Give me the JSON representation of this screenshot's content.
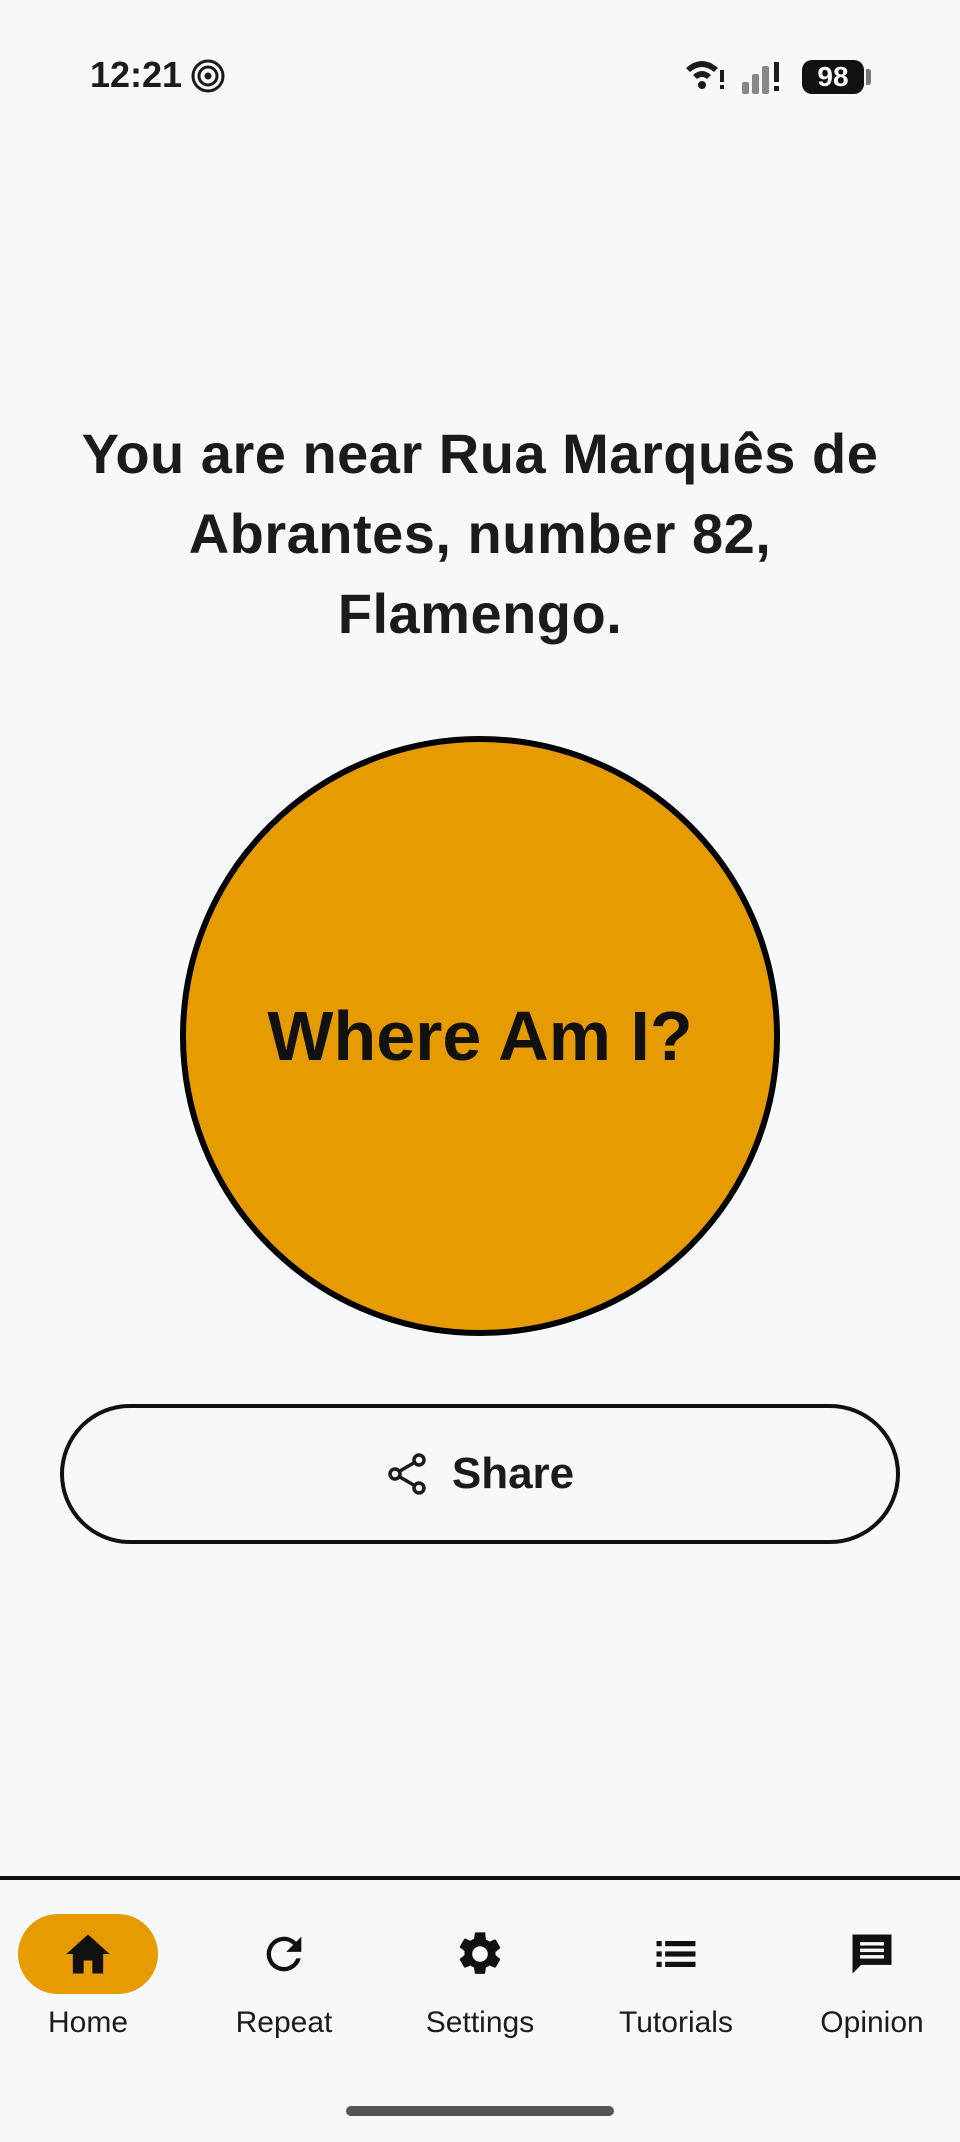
{
  "status_bar": {
    "time": "12:21",
    "battery": "98",
    "icons": [
      "spiral-icon",
      "wifi-icon",
      "signal-icon",
      "battery-icon"
    ]
  },
  "location": {
    "text": "You are near Rua Marquês de Abrantes, number 82, Flamengo."
  },
  "where_button": {
    "label": "Where Am I?",
    "color": "#e69b00"
  },
  "share_button": {
    "label": "Share",
    "icon": "share-icon"
  },
  "bottom_nav": {
    "items": [
      {
        "label": "Home",
        "icon": "home-icon",
        "active": true
      },
      {
        "label": "Repeat",
        "icon": "refresh-icon",
        "active": false
      },
      {
        "label": "Settings",
        "icon": "gear-icon",
        "active": false
      },
      {
        "label": "Tutorials",
        "icon": "list-icon",
        "active": false
      },
      {
        "label": "Opinion",
        "icon": "comment-icon",
        "active": false
      }
    ],
    "active_color": "#e69b00"
  }
}
